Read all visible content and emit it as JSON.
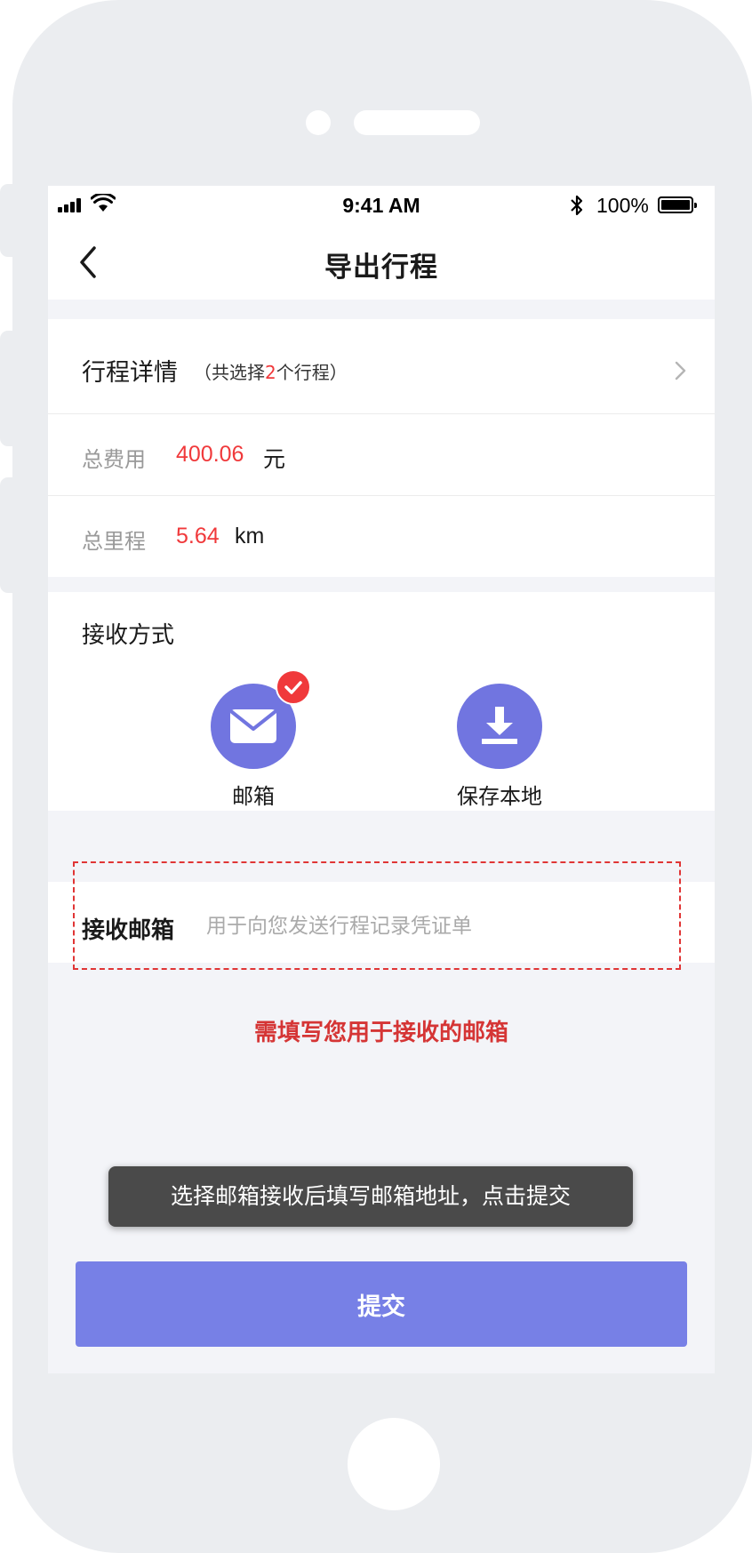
{
  "status_bar": {
    "time": "9:41 AM",
    "battery": "100%"
  },
  "nav": {
    "title": "导出行程"
  },
  "trip_detail": {
    "title": "行程详情",
    "summary_prefix": "（共选择",
    "summary_count": "2",
    "summary_suffix": "个行程）"
  },
  "total_cost": {
    "label": "总费用",
    "value": "400.06",
    "unit": "元"
  },
  "total_distance": {
    "label": "总里程",
    "value": "5.64",
    "unit": "km"
  },
  "receive_method": {
    "title": "接收方式",
    "options": [
      {
        "label": "邮箱",
        "icon": "mail-icon",
        "selected": true
      },
      {
        "label": "保存本地",
        "icon": "download-icon",
        "selected": false
      }
    ]
  },
  "email": {
    "label": "接收邮箱",
    "placeholder": "用于向您发送行程记录凭证单",
    "value": ""
  },
  "annotation_hint": "需填写您用于接收的邮箱",
  "toast": "选择邮箱接收后填写邮箱地址，点击提交",
  "submit_label": "提交",
  "colors": {
    "accent": "#7175e0",
    "button": "#7780e6",
    "red": "#f0393b",
    "background": "#f3f4f8"
  }
}
